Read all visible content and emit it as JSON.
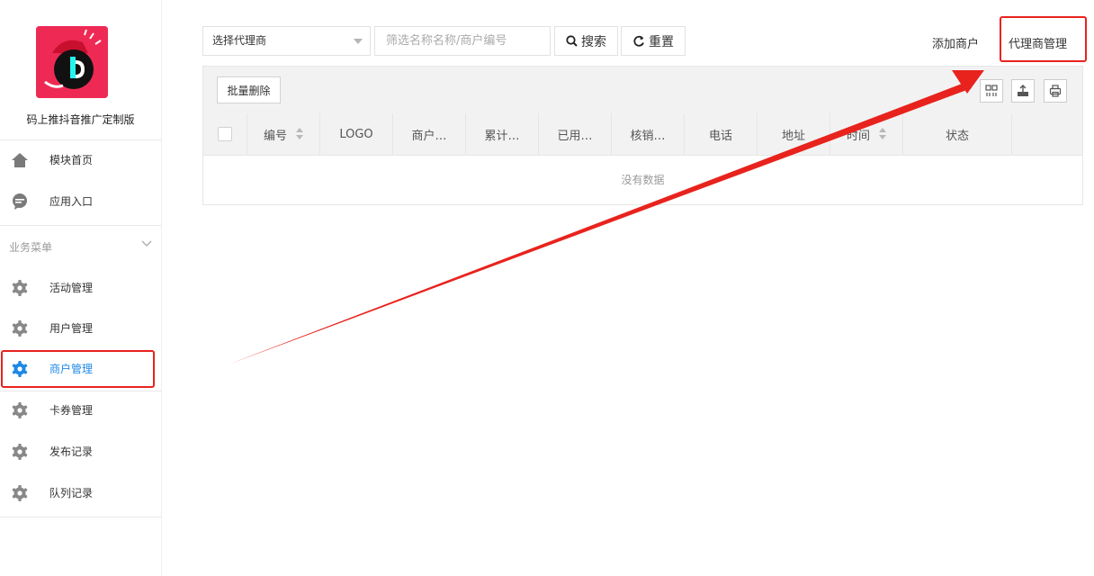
{
  "sidebar": {
    "app_name": "码上推抖音推广定制版",
    "items": [
      {
        "label": "模块首页",
        "icon": "home-icon"
      },
      {
        "label": "应用入口",
        "icon": "chat-bubble-icon"
      }
    ],
    "section_title": "业务菜单",
    "business_items": [
      {
        "label": "活动管理",
        "icon": "gear-icon"
      },
      {
        "label": "用户管理",
        "icon": "gear-icon"
      },
      {
        "label": "商户管理",
        "icon": "gear-icon",
        "active": true
      },
      {
        "label": "卡券管理",
        "icon": "gear-icon"
      },
      {
        "label": "发布记录",
        "icon": "gear-icon"
      },
      {
        "label": "队列记录",
        "icon": "gear-icon"
      }
    ]
  },
  "filter": {
    "agent_select": "选择代理商",
    "search_placeholder": "筛选名称名称/商户编号",
    "search_button": "搜索",
    "reset_button": "重置"
  },
  "top_links": {
    "add_merchant": "添加商户",
    "agent_management": "代理商管理"
  },
  "table": {
    "bulk_delete": "批量删除",
    "columns": [
      "编号",
      "LOGO",
      "商户…",
      "累计…",
      "已用…",
      "核销…",
      "电话",
      "地址",
      "时间",
      "状态"
    ],
    "empty_text": "没有数据"
  },
  "colors": {
    "accent": "#1e88e5",
    "annotation": "#e8231d",
    "logo_bg": "#ee2a54"
  }
}
